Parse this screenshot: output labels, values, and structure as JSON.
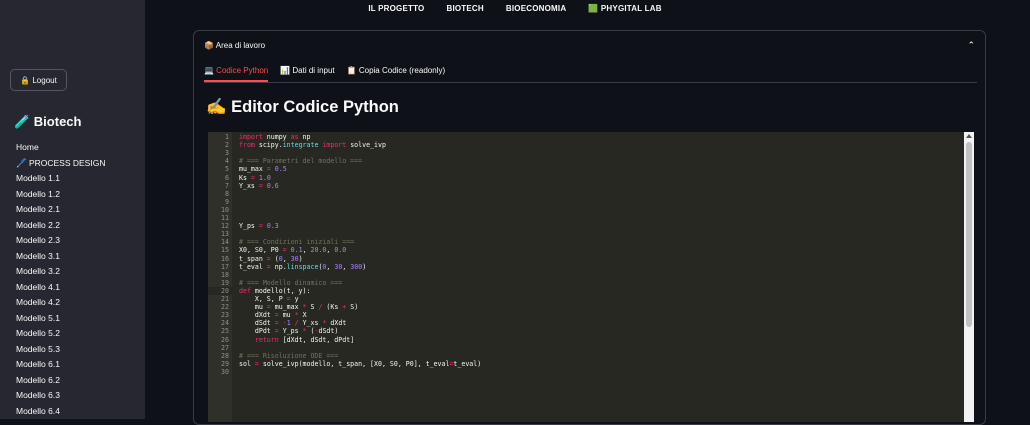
{
  "topnav": [
    "IL PROGETTO",
    "BIOTECH",
    "BIOECONOMIA",
    "🟩 PHYGITAL LAB"
  ],
  "sidebar": {
    "logout_label": "🔒 Logout",
    "section_title": "🧪 Biotech",
    "items": [
      "Home",
      "🖊️ PROCESS DESIGN",
      "Modello 1.1",
      "Modello 1.2",
      "Modello 2.1",
      "Modello 2.2",
      "Modello 2.3",
      "Modello 3.1",
      "Modello 3.2",
      "Modello 4.1",
      "Modello 4.2",
      "Modello 5.1",
      "Modello 5.2",
      "Modello 5.3",
      "Modello 6.1",
      "Modello 6.2",
      "Modello 6.3",
      "Modello 6.4"
    ]
  },
  "panel": {
    "title": "📦 Area di lavoro",
    "tabs": [
      "💻 Codice Python",
      "📊 Dati di input",
      "📋 Copia Codice (readonly)"
    ],
    "active_tab": 0
  },
  "editor": {
    "title": "✍️ Editor Codice Python",
    "line_numbers": [
      "1",
      "2",
      "3",
      "4",
      "5",
      "6",
      "7",
      "8",
      "9",
      "10",
      "11",
      "12",
      "13",
      "14",
      "15",
      "16",
      "17",
      "18",
      "19",
      "20",
      "21",
      "22",
      "23",
      "24",
      "25",
      "26",
      "27",
      "28",
      "29",
      "30"
    ],
    "lines": [
      "import numpy as np",
      "from scipy.integrate import solve_ivp",
      "",
      "# === Parametri del modello ===",
      "mu_max = 0.5",
      "Ks = 1.0",
      "Y_xs = 0.6",
      "",
      "",
      "",
      "",
      "Y_ps = 0.3",
      "",
      "# === Condizioni iniziali ===",
      "X0, S0, P0 = 0.1, 20.0, 0.0",
      "t_span = (0, 30)",
      "t_eval = np.linspace(0, 30, 300)",
      "",
      "# === Modello dinamico ===",
      "def modello(t, y):",
      "    X, S, P = y",
      "    mu = mu_max * S / (Ks + S)",
      "    dXdt = mu * X",
      "    dSdt = -1 / Y_xs * dXdt",
      "    dPdt = Y_ps * (-dSdt)",
      "    return [dXdt, dSdt, dPdt]",
      "",
      "# === Risoluzione ODE ===",
      "sol = solve_ivp(modello, t_span, [X0, S0, P0], t_eval=t_eval)",
      ""
    ]
  },
  "colors": {
    "accent": "#ff4b4b",
    "sidebar_bg": "#262730",
    "page_bg": "#0e1117",
    "code_bg": "#272822"
  }
}
